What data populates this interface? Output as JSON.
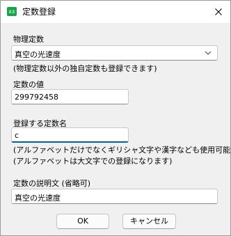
{
  "window": {
    "title": "定数登録",
    "icon_text": "x±"
  },
  "physical": {
    "label": "物理定数",
    "selected": "真空の光速度",
    "note": "(物理定数以外の独自定数も登録できます)"
  },
  "value": {
    "label": "定数の値",
    "input": "299792458"
  },
  "name": {
    "label": "登録する定数名",
    "input": "c",
    "note1": "(アルファベットだけでなくギリシャ文字や漢字なども使用可能)",
    "note2": "(アルファベットは大文字での登録になります)"
  },
  "description": {
    "label": "定数の説明文 (省略可)",
    "input": "真空の光速度"
  },
  "buttons": {
    "ok": "OK",
    "cancel": "キャンセル"
  },
  "colors": {
    "accent": "#005fb8",
    "icon_bg": "#16a34a"
  }
}
